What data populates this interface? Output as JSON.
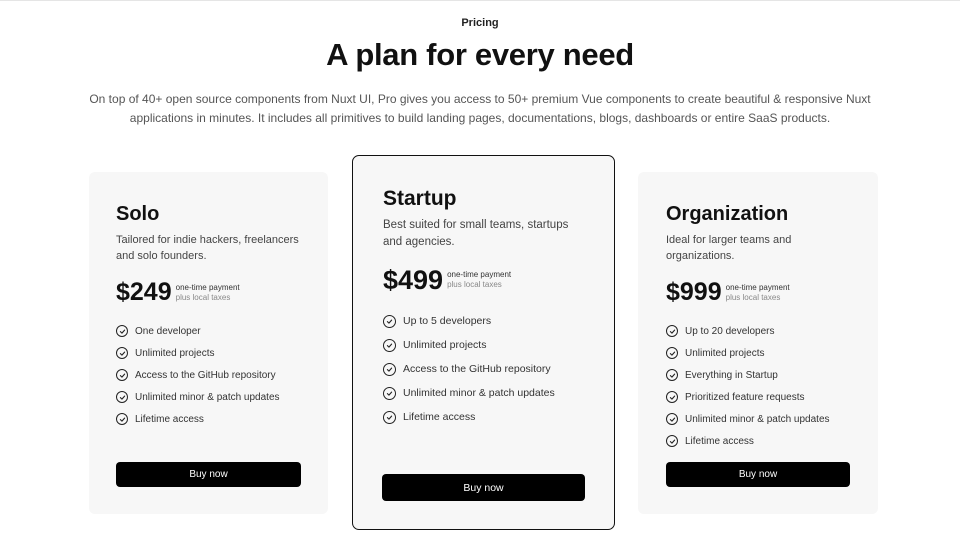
{
  "header": {
    "eyebrow": "Pricing",
    "title": "A plan for every need",
    "subtitle": "On top of 40+ open source components from Nuxt UI, Pro gives you access to 50+ premium Vue components to create beautiful & responsive Nuxt applications in minutes. It includes all primitives to build landing pages, documentations, blogs, dashboards or entire SaaS products."
  },
  "plans": [
    {
      "name": "Solo",
      "description": "Tailored for indie hackers, freelancers and solo founders.",
      "price": "$249",
      "price_note": "one-time payment",
      "tax_note": "plus local taxes",
      "features": [
        "One developer",
        "Unlimited projects",
        "Access to the GitHub repository",
        "Unlimited minor & patch updates",
        "Lifetime access"
      ],
      "button": "Buy now",
      "highlighted": false
    },
    {
      "name": "Startup",
      "description": "Best suited for small teams, startups and agencies.",
      "price": "$499",
      "price_note": "one-time payment",
      "tax_note": "plus local taxes",
      "features": [
        "Up to 5 developers",
        "Unlimited projects",
        "Access to the GitHub repository",
        "Unlimited minor & patch updates",
        "Lifetime access"
      ],
      "button": "Buy now",
      "highlighted": true
    },
    {
      "name": "Organization",
      "description": "Ideal for larger teams and organizations.",
      "price": "$999",
      "price_note": "one-time payment",
      "tax_note": "plus local taxes",
      "features": [
        "Up to 20 developers",
        "Unlimited projects",
        "Everything in Startup",
        "Prioritized feature requests",
        "Unlimited minor & patch updates",
        "Lifetime access"
      ],
      "button": "Buy now",
      "highlighted": false
    }
  ],
  "icons": {
    "feature": "check-circle-icon"
  },
  "colors": {
    "button_bg": "#000000",
    "card_bg": "#f7f7f7",
    "highlight_border": "#111111"
  }
}
